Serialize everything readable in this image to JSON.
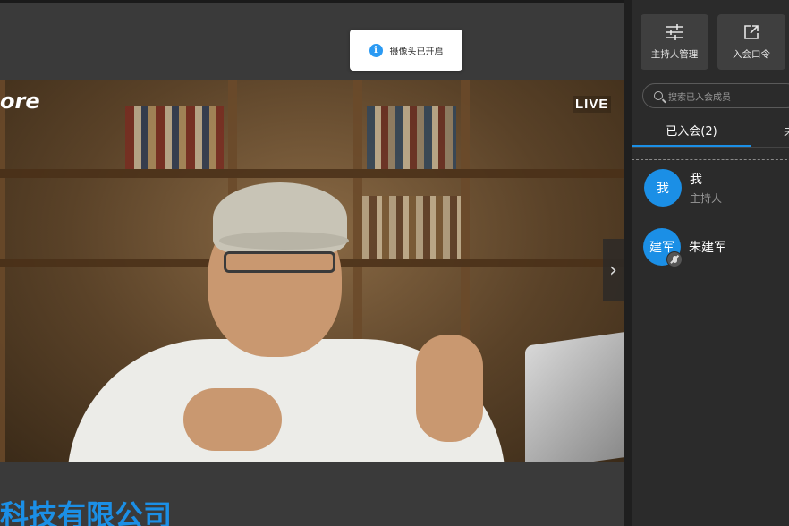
{
  "toast": {
    "text": "摄像头已开启",
    "icon": "info-icon"
  },
  "video": {
    "logo_text": "ore",
    "live_label": "LIVE",
    "next_icon": "chevron-right-icon"
  },
  "footer": {
    "company": "科技有限公司",
    "color": "#1b8fe6"
  },
  "sidebar": {
    "tools": [
      {
        "label": "主持人管理",
        "icon": "sliders-icon"
      },
      {
        "label": "入会口令",
        "icon": "share-external-icon"
      }
    ],
    "search": {
      "placeholder": "搜索已入会成员"
    },
    "tabs": [
      {
        "label": "已入会(2)",
        "active": true
      },
      {
        "label": "未"
      }
    ],
    "members": [
      {
        "avatar": "我",
        "name": "我",
        "role": "主持人",
        "selected": true
      },
      {
        "avatar": "建军",
        "name": "朱建军",
        "role": "",
        "mic_muted": true
      }
    ]
  },
  "colors": {
    "accent": "#1b8fe6",
    "background": "#3a3a3a",
    "sidebar": "#2b2b2b"
  }
}
